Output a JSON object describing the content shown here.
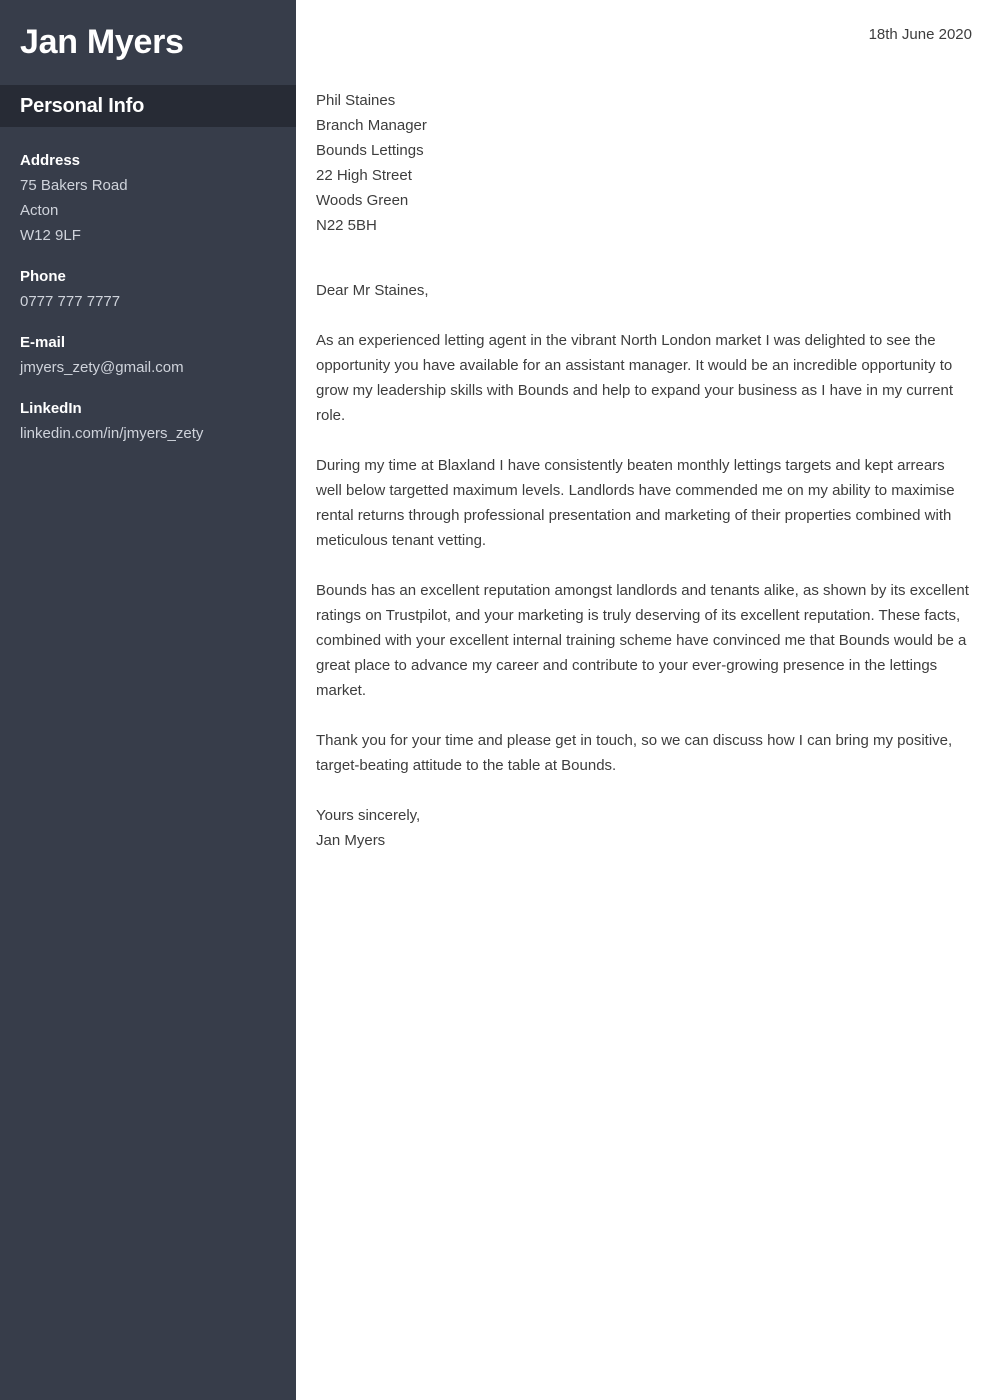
{
  "sidebar": {
    "name": "Jan Myers",
    "section_title": "Personal Info",
    "background_color": "#373d4a",
    "section_band_color": "#272b35",
    "contacts": [
      {
        "label": "Address",
        "values": [
          "75 Bakers Road",
          "Acton",
          "W12 9LF"
        ]
      },
      {
        "label": "Phone",
        "values": [
          "0777 777 7777"
        ]
      },
      {
        "label": "E-mail",
        "values": [
          "jmyers_zety@gmail.com"
        ]
      },
      {
        "label": "LinkedIn",
        "values": [
          "linkedin.com/in/jmyers_zety"
        ]
      }
    ]
  },
  "letter": {
    "date": "18th June 2020",
    "recipient": [
      "Phil Staines",
      "Branch Manager",
      "Bounds Lettings",
      "22 High Street",
      "Woods Green",
      "N22 5BH"
    ],
    "salutation": "Dear Mr Staines,",
    "paragraphs": [
      "As an experienced letting agent in the vibrant North London market I was delighted to see the opportunity you have available for an assistant manager. It would be an incredible opportunity to grow my leadership skills with Bounds and help to expand your business as I have in my current role.",
      "During my time at Blaxland I have consistently beaten monthly lettings targets and kept arrears well below targetted maximum levels. Landlords have commended me on my ability to maximise rental returns through professional presentation and marketing of their properties combined with meticulous tenant vetting.",
      "Bounds has an excellent reputation amongst landlords and tenants alike, as shown by its excellent ratings on Trustpilot, and your marketing is truly deserving of its excellent reputation. These facts, combined with your excellent internal training scheme have convinced me that Bounds would be a great place to advance my career and contribute to your ever-growing presence in the lettings market.",
      "Thank you for your time and please get in touch, so we can discuss how I can bring my positive, target-beating attitude to the table at Bounds."
    ],
    "closing": "Yours sincerely,",
    "signature": "Jan Myers",
    "text_color": "#3d3d3d"
  }
}
